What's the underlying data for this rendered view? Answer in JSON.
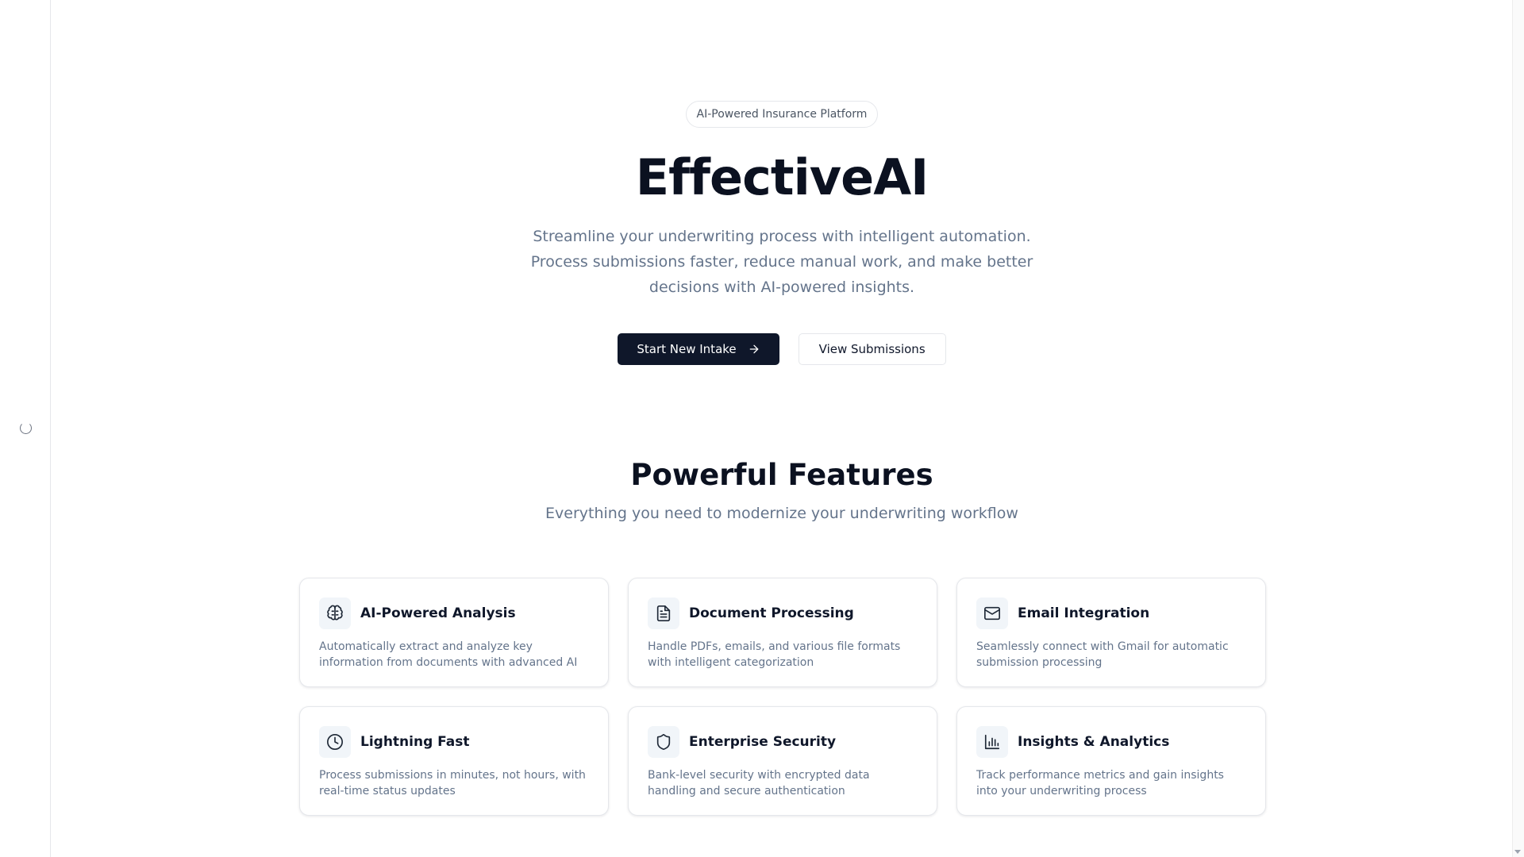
{
  "hero": {
    "badge": "AI-Powered Insurance Platform",
    "title": "EffectiveAI",
    "subtitle": "Streamline your underwriting process with intelligent automation. Process submissions faster, reduce manual work, and make better decisions with AI-powered insights.",
    "primary_button": "Start New Intake",
    "primary_button_icon": "arrow-right-icon",
    "secondary_button": "View Submissions"
  },
  "features": {
    "title": "Powerful Features",
    "subtitle": "Everything you need to modernize your underwriting workflow",
    "items": [
      {
        "icon": "brain-icon",
        "title": "AI-Powered Analysis",
        "description": "Automatically extract and analyze key information from documents with advanced AI"
      },
      {
        "icon": "document-icon",
        "title": "Document Processing",
        "description": "Handle PDFs, emails, and various file formats with intelligent categorization"
      },
      {
        "icon": "mail-icon",
        "title": "Email Integration",
        "description": "Seamlessly connect with Gmail for automatic submission processing"
      },
      {
        "icon": "clock-icon",
        "title": "Lightning Fast",
        "description": "Process submissions in minutes, not hours, with real-time status updates"
      },
      {
        "icon": "shield-icon",
        "title": "Enterprise Security",
        "description": "Bank-level security with encrypted data handling and secure authentication"
      },
      {
        "icon": "bar-chart-icon",
        "title": "Insights & Analytics",
        "description": "Track performance metrics and gain insights into your underwriting process"
      }
    ]
  },
  "colors": {
    "primary": "#0f172a",
    "muted_text": "#64748b",
    "border": "#e5e7eb",
    "icon_bg": "#f1f5f9"
  },
  "sidebar": {
    "loading_icon": "loading-spinner-icon"
  }
}
